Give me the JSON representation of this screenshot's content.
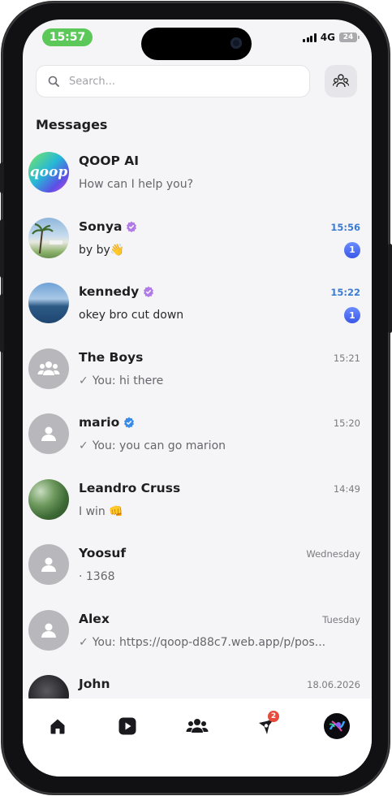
{
  "status_bar": {
    "time": "15:57",
    "network": "4G",
    "battery": "24"
  },
  "search": {
    "placeholder": "Search..."
  },
  "section_title": "Messages",
  "chats": [
    {
      "name": "QOOP AI",
      "preview": "How can I help you?",
      "time": "",
      "unread": "",
      "verified": "",
      "avatar": "qoop-logo",
      "logo_text": "qoop"
    },
    {
      "name": "Sonya",
      "preview": "by by👋",
      "time": "15:56",
      "unread": "1",
      "verified": "purple",
      "avatar": "photo-beach"
    },
    {
      "name": "kennedy",
      "preview": "okey bro cut down",
      "time": "15:22",
      "unread": "1",
      "verified": "purple",
      "avatar": "photo-sea"
    },
    {
      "name": "The Boys",
      "preview": "You: hi there",
      "time": "15:21",
      "unread": "",
      "verified": "",
      "avatar": "group-placeholder",
      "sent_check": true
    },
    {
      "name": "mario",
      "preview": "You: you can go marion",
      "time": "15:20",
      "unread": "",
      "verified": "blue",
      "avatar": "user-placeholder",
      "sent_check": true
    },
    {
      "name": "Leandro Cruss",
      "preview": "I win 👊",
      "time": "14:49",
      "unread": "",
      "verified": "",
      "avatar": "photo-trees"
    },
    {
      "name": "Yoosuf",
      "preview": "· 1368",
      "time": "Wednesday",
      "unread": "",
      "verified": "",
      "avatar": "user-placeholder"
    },
    {
      "name": "Alex",
      "preview": "You: https://qoop-d88c7.web.app/p/pos...",
      "time": "Tuesday",
      "unread": "",
      "verified": "",
      "avatar": "user-placeholder",
      "sent_check": true
    },
    {
      "name": "John",
      "preview": "",
      "time": "18.06.2026",
      "unread": "",
      "verified": "",
      "avatar": "photo-dark"
    }
  ],
  "bottom_nav": {
    "items": [
      {
        "icon": "home-icon"
      },
      {
        "icon": "play-icon"
      },
      {
        "icon": "groups-icon"
      },
      {
        "icon": "notifications-icon",
        "badge": "2"
      },
      {
        "icon": "profile-avatar"
      }
    ]
  },
  "colors": {
    "accent": "#3a7bd5",
    "verified_purple": "#b07be6",
    "verified_blue": "#3a8be8",
    "status_green": "#5cc85a",
    "badge_red": "#e84a3c"
  }
}
